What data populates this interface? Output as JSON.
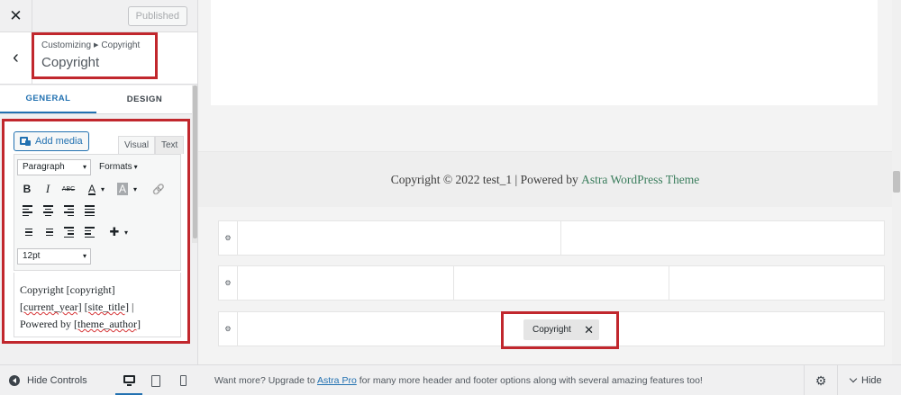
{
  "topbar": {
    "close_glyph": "✕",
    "published_label": "Published"
  },
  "section": {
    "back_glyph": "‹",
    "breadcrumb_parent": "Customizing",
    "breadcrumb_sep": "▶",
    "breadcrumb_current": "Copyright",
    "title": "Copyright"
  },
  "tabs": [
    {
      "label": "GENERAL",
      "active": true
    },
    {
      "label": "DESIGN",
      "active": false
    }
  ],
  "editor": {
    "add_media_label": "Add media",
    "mode_visual": "Visual",
    "mode_text": "Text",
    "format_select": "Paragraph",
    "formats_label": "Formats",
    "fontsize_select": "12pt",
    "caret": "▾",
    "toolbar_icons": [
      "bold-icon",
      "italic-icon",
      "strikethrough-icon",
      "text-color-icon",
      "background-color-icon",
      "link-icon",
      "align-left-icon",
      "align-center-icon",
      "align-right-icon",
      "align-justify-icon",
      "ordered-list-icon",
      "unordered-list-icon",
      "outdent-icon",
      "indent-icon",
      "insert-icon"
    ],
    "glyphs": {
      "bold": "B",
      "italic": "I",
      "strike": "ABC",
      "text_color": "A",
      "bg_color": "A",
      "link": "🔗",
      "plus": "✚"
    },
    "content": {
      "line1_text": "Copyright ",
      "line1_code": "[copyright]",
      "line2_code1": "[current_year]",
      "line2_code2": "[site_title]",
      "line2_pipe": " |",
      "line3_text": "Powered by ",
      "line3_code": "[theme_author]"
    }
  },
  "bottom_bar": {
    "hide_controls_label": "Hide Controls",
    "upgrade_prefix": "Want more? Upgrade to ",
    "upgrade_link": "Astra Pro",
    "upgrade_suffix": " for many more header and footer options along with several amazing features too!",
    "gear_glyph": "⚙",
    "hide_label": "Hide"
  },
  "preview": {
    "footer_prefix": "Copyright © 2022 test_1 | Powered by ",
    "footer_link": "Astra WordPress Theme",
    "row_gear_glyph": "⚙",
    "copyright_chip_label": "Copyright",
    "chip_close_glyph": "✕"
  },
  "colors": {
    "accent": "#2271b1",
    "highlight_border": "#c1272d",
    "footer_link": "#3a7d5c"
  }
}
